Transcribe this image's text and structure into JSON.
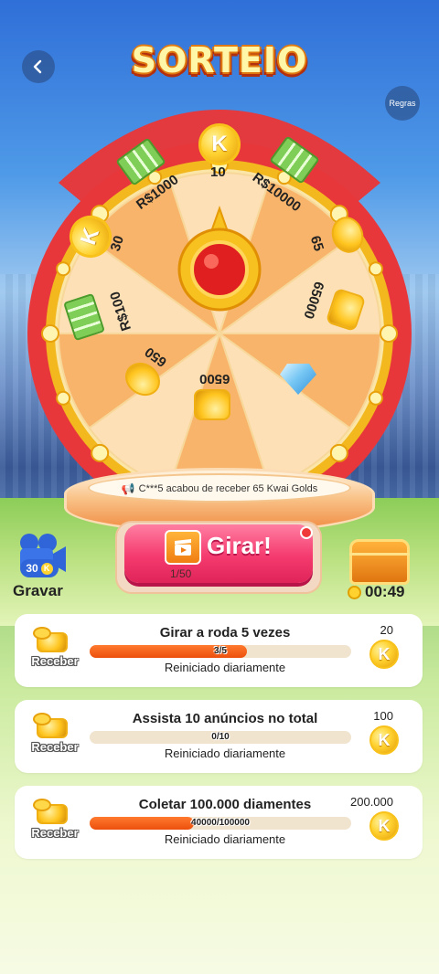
{
  "header": {
    "title": "SORTEIO",
    "regras_label": "Regras"
  },
  "wheel": {
    "segments": [
      {
        "label": "10",
        "icon": "k-coin-icon"
      },
      {
        "label": "R$10000",
        "icon": "cash-stack-icon"
      },
      {
        "label": "65",
        "icon": "gold-coins-icon"
      },
      {
        "label": "65000",
        "icon": "gold-bar-icon"
      },
      {
        "label": "",
        "icon": "diamond-icon"
      },
      {
        "label": "6500",
        "icon": "gold-bar-icon"
      },
      {
        "label": "650",
        "icon": "gold-coins-icon"
      },
      {
        "label": "R$100",
        "icon": "cash-stack-icon"
      },
      {
        "label": "30",
        "icon": "k-coin-icon"
      },
      {
        "label": "R$1000",
        "icon": "cash-stack-icon"
      }
    ],
    "coin_letter": "K"
  },
  "ticker": {
    "text": "C***5 acabou de receber 65 Kwai Golds"
  },
  "spin": {
    "label": "Girar!",
    "count": "1/50"
  },
  "gravar": {
    "coins": "30",
    "label": "Gravar"
  },
  "chest": {
    "timer": "00:49"
  },
  "tasks": [
    {
      "title": "Girar a roda  5  vezes",
      "progress_text": "3/5",
      "progress": 0.6,
      "subtitle": "Reiniciado diariamente",
      "reward": "20",
      "button": "Receber"
    },
    {
      "title": "Assista 10 anúncios no total",
      "progress_text": "0/10",
      "progress": 0.0,
      "subtitle": "Reiniciado diariamente",
      "reward": "100",
      "button": "Receber"
    },
    {
      "title": "Coletar 100.000 diamentes",
      "progress_text": "40000/100000",
      "progress": 0.4,
      "subtitle": "Reiniciado diariamente",
      "reward": "200.000",
      "button": "Receber"
    }
  ],
  "colors": {
    "wheel_rim": "#e8373b",
    "wheel_gold": "#f2b81e",
    "segment_light": "#fde0b5",
    "segment_dark": "#f8b46a",
    "spin_button": "#f43a6e",
    "progress_fill": "#ec4f0c"
  }
}
